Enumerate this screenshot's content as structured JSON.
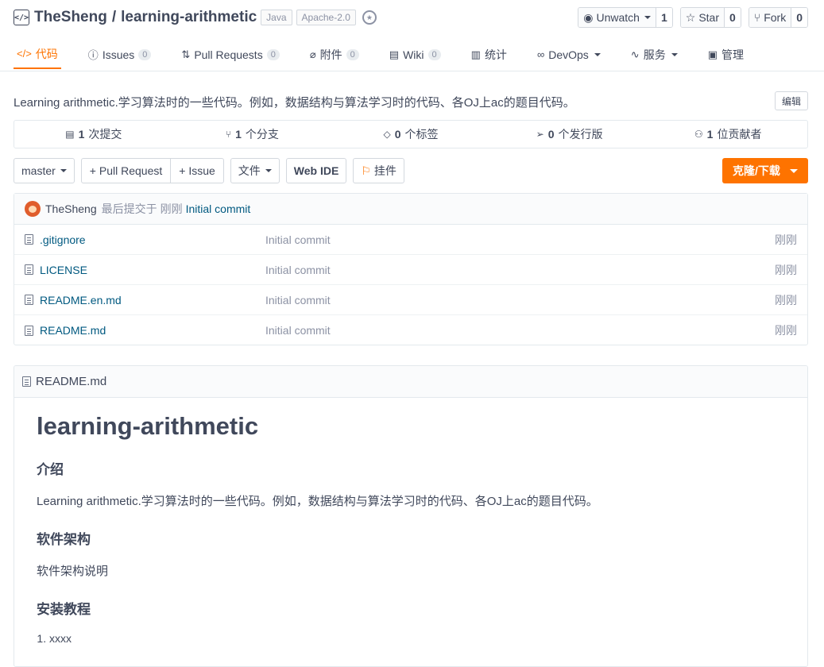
{
  "header": {
    "owner": "TheSheng",
    "separator": "/",
    "repo": "learning-arithmetic",
    "tags": [
      "Java",
      "Apache-2.0"
    ],
    "watch": {
      "label": "Unwatch",
      "count": "1"
    },
    "star": {
      "label": "Star",
      "count": "0"
    },
    "fork": {
      "label": "Fork",
      "count": "0"
    }
  },
  "tabs": [
    {
      "label": "代码",
      "icon": "code-icon",
      "badge": ""
    },
    {
      "label": "Issues",
      "icon": "issue-icon",
      "badge": "0"
    },
    {
      "label": "Pull Requests",
      "icon": "pr-icon",
      "badge": "0"
    },
    {
      "label": "附件",
      "icon": "paperclip-icon",
      "badge": "0"
    },
    {
      "label": "Wiki",
      "icon": "book-icon",
      "badge": "0"
    },
    {
      "label": "统计",
      "icon": "chart-icon",
      "badge": ""
    },
    {
      "label": "DevOps",
      "icon": "infinity-icon",
      "badge": ""
    },
    {
      "label": "服务",
      "icon": "pulse-icon",
      "badge": ""
    },
    {
      "label": "管理",
      "icon": "settings-doc-icon",
      "badge": ""
    }
  ],
  "description": "Learning arithmetic.学习算法时的一些代码。例如，数据结构与算法学习时的代码、各OJ上ac的题目代码。",
  "edit_label": "编辑",
  "stats": [
    {
      "count": "1",
      "label": "次提交"
    },
    {
      "count": "1",
      "label": "个分支"
    },
    {
      "count": "0",
      "label": "个标签"
    },
    {
      "count": "0",
      "label": "个发行版"
    },
    {
      "count": "1",
      "label": "位贡献者"
    }
  ],
  "toolbar": {
    "branch": "master",
    "pull_request": "+ Pull Request",
    "issue": "+ Issue",
    "file": "文件",
    "web_ide": "Web IDE",
    "widget": "挂件",
    "clone": "克隆/下载"
  },
  "last_commit": {
    "user": "TheSheng",
    "text": "最后提交于",
    "time": "刚刚",
    "message": "Initial commit"
  },
  "files": [
    {
      "name": ".gitignore",
      "message": "Initial commit",
      "time": "刚刚"
    },
    {
      "name": "LICENSE",
      "message": "Initial commit",
      "time": "刚刚"
    },
    {
      "name": "README.en.md",
      "message": "Initial commit",
      "time": "刚刚"
    },
    {
      "name": "README.md",
      "message": "Initial commit",
      "time": "刚刚"
    }
  ],
  "readme": {
    "filename": "README.md",
    "h1": "learning-arithmetic",
    "intro_title": "介绍",
    "intro_text": "Learning arithmetic.学习算法时的一些代码。例如，数据结构与算法学习时的代码、各OJ上ac的题目代码。",
    "arch_title": "软件架构",
    "arch_text": "软件架构说明",
    "install_title": "安装教程",
    "install_items": [
      "xxxx"
    ]
  }
}
